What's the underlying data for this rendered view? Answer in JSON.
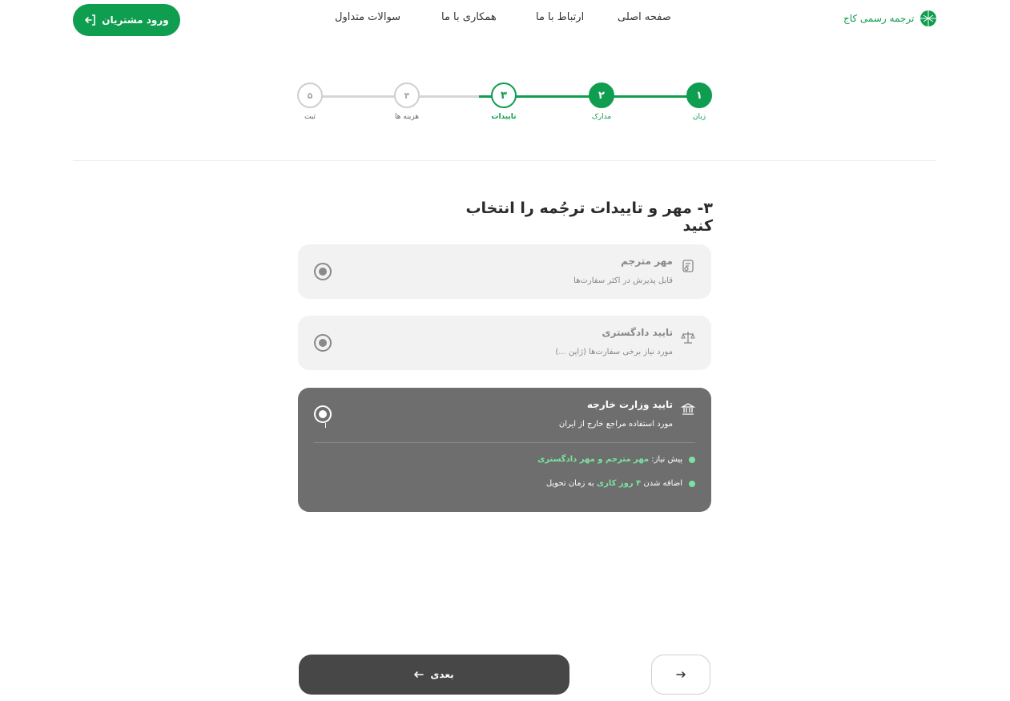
{
  "header": {
    "login_label": "ورود مشتریان",
    "brand_name": "ترجمه رسمی کاج",
    "nav": {
      "home": "صفحه اصلی",
      "contact": "ارتباط با ما",
      "cooperation": "همکاری با ما",
      "faq": "سوالات متداول"
    }
  },
  "stepper": {
    "steps": [
      {
        "num": "۱",
        "label": "زبان",
        "state": "done"
      },
      {
        "num": "۲",
        "label": "مدارک",
        "state": "done"
      },
      {
        "num": "۳",
        "label": "تاییدات",
        "state": "active"
      },
      {
        "num": "۴",
        "label": "هزینه ها",
        "state": "todo"
      },
      {
        "num": "۵",
        "label": "ثبت",
        "state": "todo"
      }
    ]
  },
  "section": {
    "title": "۳- مهر و تاییدات ترجُمه را انتخاب کنید"
  },
  "options": [
    {
      "title": "مهر مترجم",
      "subtitle": "قابل پذیرش در اکثر سفارت‌ها",
      "icon": "certificate-icon",
      "selected": false
    },
    {
      "title": "تایید دادگستری",
      "subtitle": "مورد نیاز برخی سفارت‌ها (ژاپن ...)",
      "icon": "scales-icon",
      "selected": false
    },
    {
      "title": "تایید وزارت خارجه",
      "subtitle": "مورد استفاده مراجع خارج از ایران",
      "icon": "bank-icon",
      "selected": true,
      "requirements": {
        "prereq_prefix": "پیش نیاز:",
        "prereq_value": "مهر مترجم و مهر دادگستری",
        "time_prefix": "اضافه شدن",
        "time_value": "۴ روز کاری",
        "time_suffix": "به زمان تحویل"
      }
    }
  ],
  "footer": {
    "next_label": "بعدی"
  },
  "colors": {
    "brand_green": "#0f9d4f",
    "selected_card": "#6e6e6e",
    "bullet_green": "#7be3a1",
    "next_button": "#474747"
  }
}
